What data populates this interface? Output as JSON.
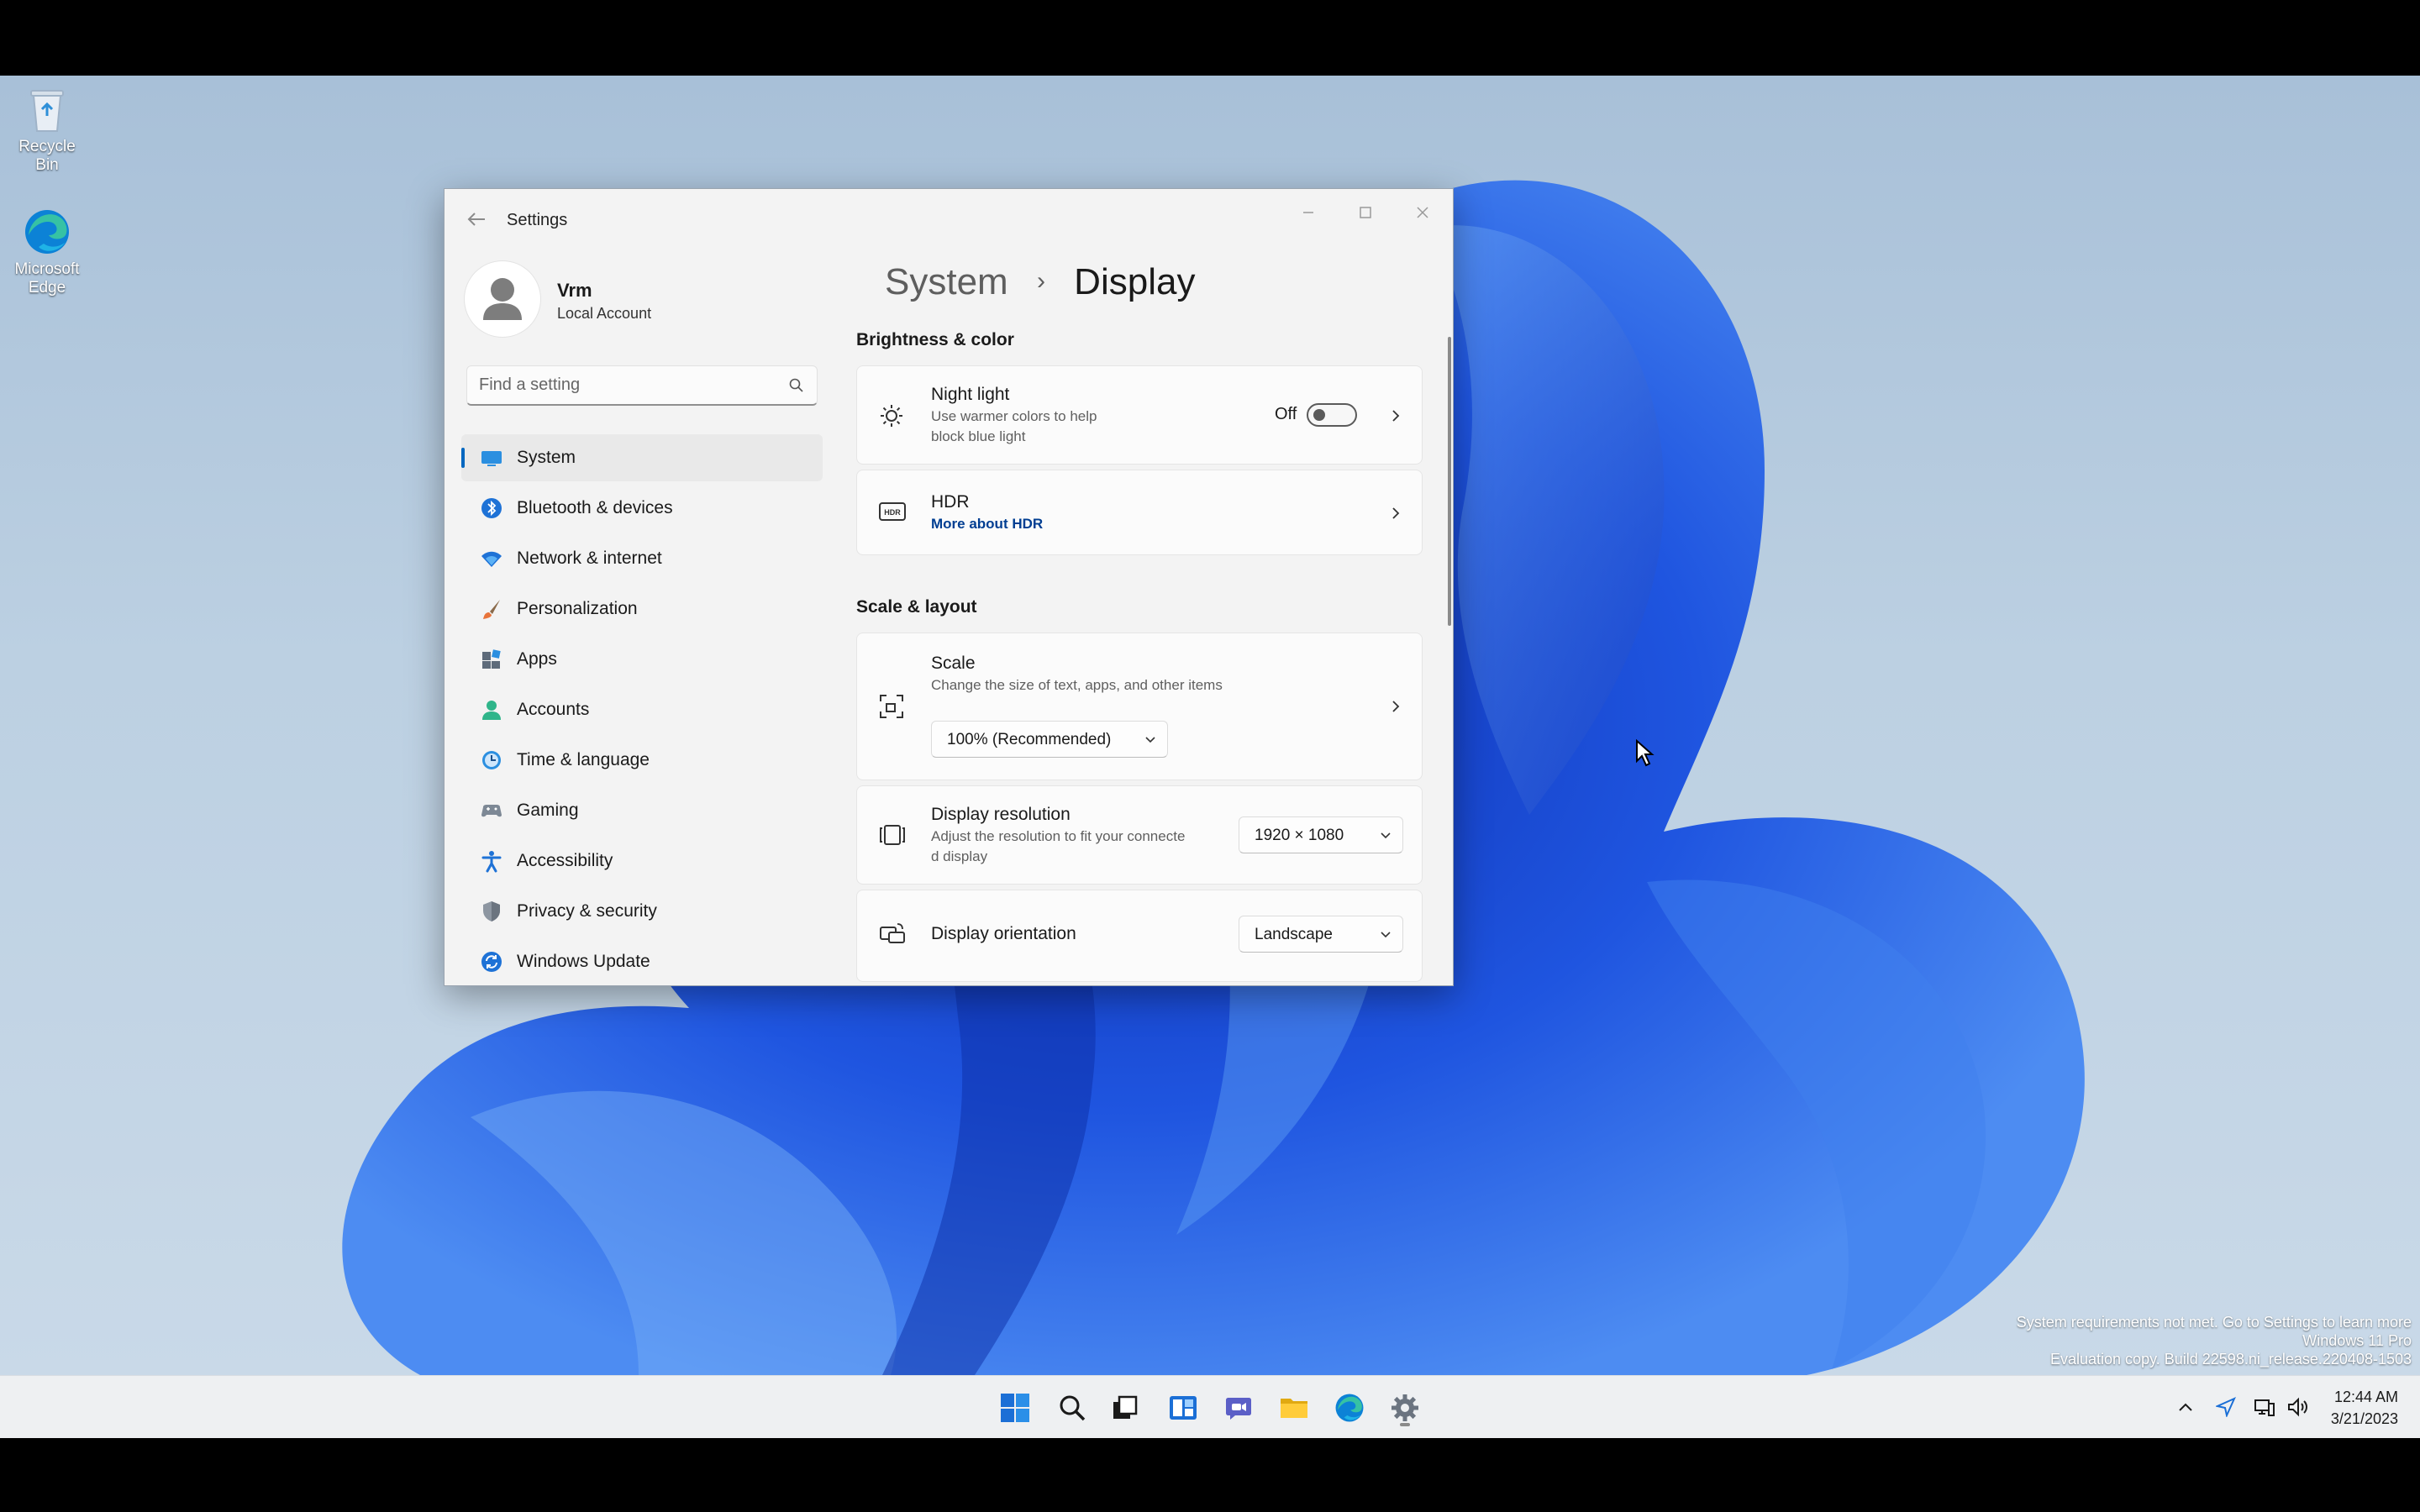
{
  "desktop": {
    "icons": [
      {
        "label": "Recycle Bin",
        "icon": "recycle-bin-icon"
      },
      {
        "label": "Microsoft Edge",
        "icon": "edge-icon"
      }
    ],
    "watermark": [
      "System requirements not met. Go to Settings to learn more",
      "Windows 11 Pro",
      "Evaluation copy. Build 22598.ni_release.220408-1503"
    ]
  },
  "window": {
    "title": "Settings",
    "back_icon": "back-arrow-icon",
    "caption_buttons": [
      "minimize",
      "maximize",
      "close"
    ]
  },
  "profile": {
    "name": "Vrm",
    "account_type": "Local Account"
  },
  "search": {
    "placeholder": "Find a setting"
  },
  "nav": {
    "items": [
      {
        "label": "System",
        "icon": "system-icon",
        "selected": true
      },
      {
        "label": "Bluetooth & devices",
        "icon": "bluetooth-icon"
      },
      {
        "label": "Network & internet",
        "icon": "wifi-icon"
      },
      {
        "label": "Personalization",
        "icon": "brush-icon"
      },
      {
        "label": "Apps",
        "icon": "apps-icon"
      },
      {
        "label": "Accounts",
        "icon": "accounts-icon"
      },
      {
        "label": "Time & language",
        "icon": "time-language-icon"
      },
      {
        "label": "Gaming",
        "icon": "gaming-icon"
      },
      {
        "label": "Accessibility",
        "icon": "accessibility-icon"
      },
      {
        "label": "Privacy & security",
        "icon": "shield-icon"
      },
      {
        "label": "Windows Update",
        "icon": "update-icon"
      }
    ]
  },
  "page": {
    "breadcrumb_parent": "System",
    "breadcrumb_separator": "›",
    "breadcrumb_current": "Display",
    "sections": {
      "brightness": "Brightness & color",
      "scale_layout": "Scale & layout"
    },
    "night_light": {
      "title": "Night light",
      "subtitle_line1": "Use warmer colors to help",
      "subtitle_line2": "block blue light",
      "state_label": "Off",
      "on": false
    },
    "hdr": {
      "title": "HDR",
      "link": "More about HDR"
    },
    "scale": {
      "title": "Scale",
      "subtitle": "Change the size of text, apps, and other items",
      "value": "100% (Recommended)"
    },
    "resolution": {
      "title": "Display resolution",
      "subtitle_line1": "Adjust the resolution to fit your connecte",
      "subtitle_line2": "d display",
      "value": "1920 × 1080"
    },
    "orientation": {
      "title": "Display orientation",
      "value": "Landscape"
    }
  },
  "taskbar": {
    "apps": [
      "start-icon",
      "search-icon",
      "task-view-icon",
      "widgets-icon",
      "chat-icon",
      "file-explorer-icon",
      "edge-icon",
      "settings-icon"
    ],
    "tray_icons": [
      "chevron-up-icon",
      "location-icon",
      "network-icon",
      "volume-icon"
    ],
    "time": "12:44 AM",
    "date": "3/21/2023"
  },
  "colors": {
    "accent": "#0067c0",
    "link": "#003e92",
    "bloom": "#1f4fd6"
  }
}
